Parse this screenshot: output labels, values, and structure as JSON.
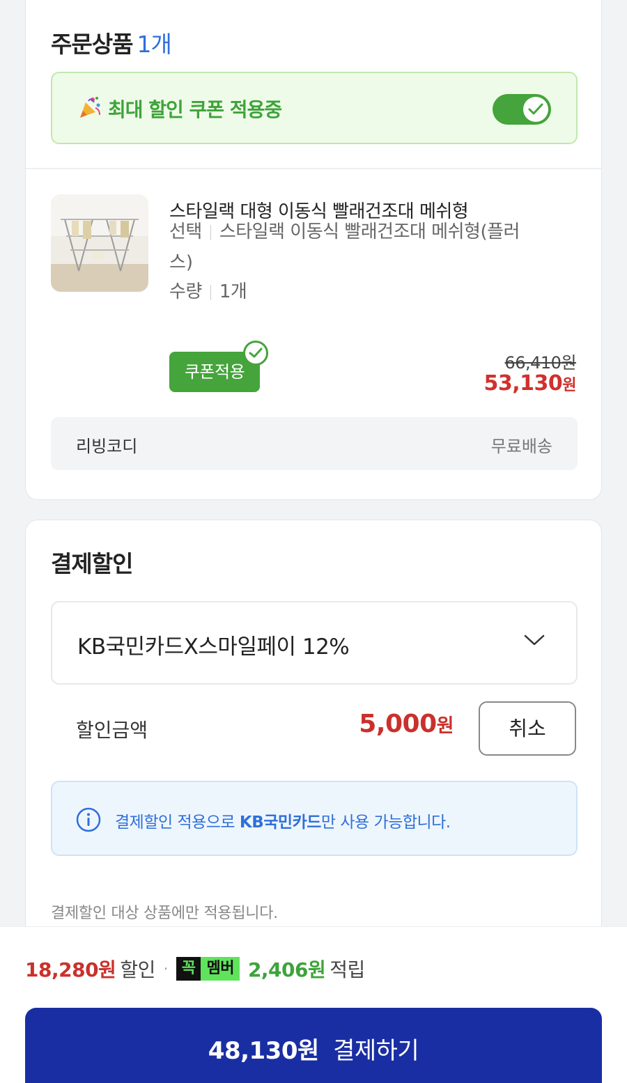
{
  "order": {
    "title": "주문상품",
    "count": "1개",
    "coupon_banner_text": "최대 할인 쿠폰 적용중",
    "coupon_toggle_on": true,
    "product": {
      "name": "스타일랙 대형 이동식 빨래건조대 메쉬형",
      "option_label": "선택",
      "option_value": "스타일랙 이동식 빨래건조대 메쉬형(플러",
      "option_value_cont": "스)",
      "qty_label": "수량",
      "qty_value": "1개",
      "coupon_chip": "쿠폰적용",
      "original_price": "66,410",
      "original_currency": "원",
      "sale_price": "53,130",
      "sale_currency": "원"
    },
    "seller": {
      "name": "리빙코디",
      "shipping": "무료배송"
    }
  },
  "payment_discount": {
    "title": "결제할인",
    "selected_card": "KB국민카드X스마일페이 12%",
    "discount_label": "할인금액",
    "discount_amount": "5,000",
    "discount_currency": "원",
    "cancel_label": "취소",
    "info_prefix": "결제할인 적용으로 ",
    "info_highlight": "KB국민카드",
    "info_suffix": "만 사용 가능합니다.",
    "footnote": "결제할인 대상 상품에만 적용됩니다."
  },
  "bottom": {
    "discount_total": "18,280원",
    "discount_word": "할인",
    "dot": "·",
    "badge_left": "꼭",
    "badge_right": "멤버",
    "points": "2,406원",
    "points_word": "적립",
    "pay_amount": "48,130원",
    "pay_label": "결제하기"
  },
  "colors": {
    "accent_green": "#45a43b",
    "price_red": "#c9312c",
    "link_blue": "#2f6fd9",
    "pay_button": "#1a2ea3"
  }
}
